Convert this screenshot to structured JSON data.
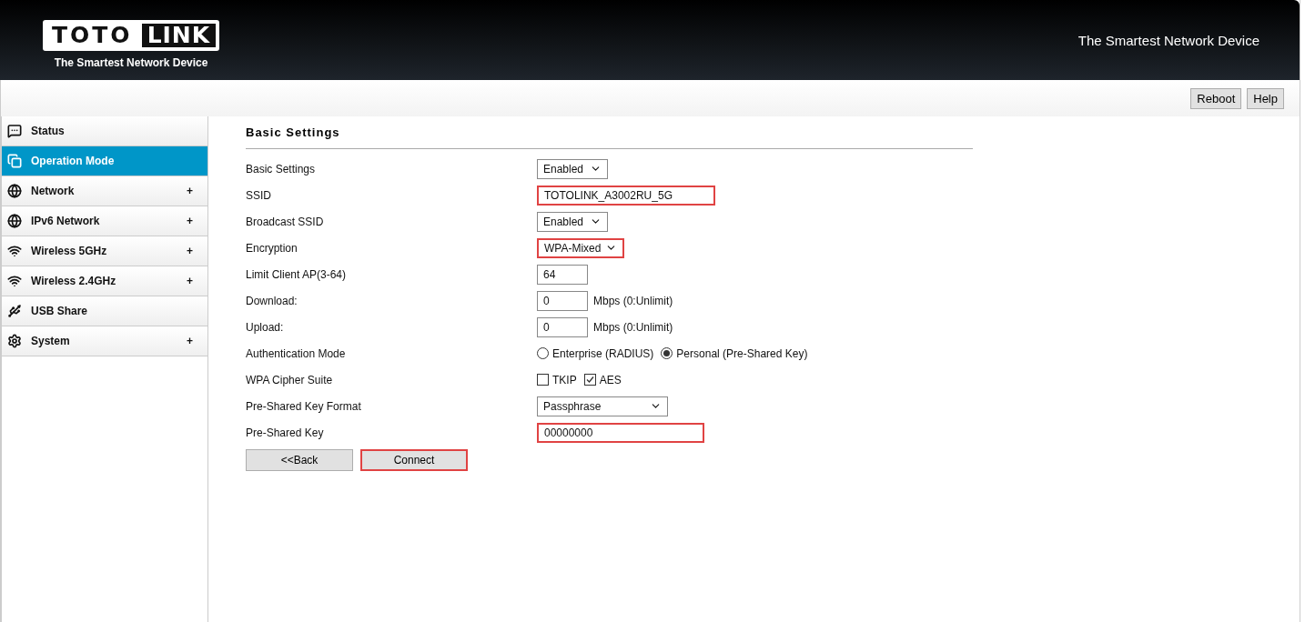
{
  "header": {
    "logo_left": "TOTO",
    "logo_right": "LINK",
    "logo_tagline": "The Smartest Network Device",
    "tagline": "The Smartest Network Device"
  },
  "toolbar": {
    "buttons": [
      "Reboot",
      "Help"
    ]
  },
  "sidebar": {
    "items": [
      {
        "label": "Status",
        "selected": false
      },
      {
        "label": "Operation Mode",
        "selected": true
      },
      {
        "label": "Network",
        "selected": false,
        "expand_symbol": "+"
      },
      {
        "label": "IPv6 Network",
        "selected": false,
        "expand_symbol": "+"
      },
      {
        "label": "Wireless 5GHz",
        "selected": false,
        "expand_symbol": "+"
      },
      {
        "label": "Wireless 2.4GHz",
        "selected": false,
        "expand_symbol": "+"
      },
      {
        "label": "USB Share",
        "selected": false
      },
      {
        "label": "System",
        "selected": false,
        "expand_symbol": "+"
      }
    ]
  },
  "content": {
    "title": "Basic Settings",
    "rows": [
      {
        "kind": "select",
        "label": "Basic Settings",
        "value": "Enabled",
        "highlighted": false
      },
      {
        "kind": "text",
        "label": "SSID",
        "value": "TOTOLINK_A3002RU_5G",
        "highlighted": true
      },
      {
        "kind": "select",
        "label": "Broadcast SSID",
        "value": "Enabled",
        "highlighted": false
      },
      {
        "kind": "select",
        "label": "Encryption",
        "value": "WPA-Mixed",
        "highlighted": true
      },
      {
        "kind": "text",
        "label": "Limit Client AP(3-64)",
        "value": "64",
        "highlighted": false
      },
      {
        "kind": "text",
        "label": "Download:",
        "value": "0",
        "unit": "Mbps (0:Unlimit)",
        "highlighted": false
      },
      {
        "kind": "text",
        "label": "Upload:",
        "value": "0",
        "unit": "Mbps (0:Unlimit)",
        "highlighted": false
      },
      {
        "kind": "radio",
        "label": "Authentication Mode",
        "options": [
          {
            "label": "Enterprise (RADIUS)",
            "selected": false
          },
          {
            "label": "Personal (Pre-Shared Key)",
            "selected": true
          }
        ]
      },
      {
        "kind": "checkbox",
        "label": "WPA Cipher Suite",
        "options": [
          {
            "label": "TKIP",
            "checked": false
          },
          {
            "label": "AES",
            "checked": true
          }
        ]
      },
      {
        "kind": "select",
        "label": "Pre-Shared Key Format",
        "value": "Passphrase",
        "highlighted": false
      },
      {
        "kind": "text",
        "label": "Pre-Shared Key",
        "value": "00000000",
        "highlighted": true
      }
    ],
    "buttons": [
      {
        "label": "<<Back",
        "highlighted": false
      },
      {
        "label": "Connect",
        "highlighted": true
      }
    ]
  }
}
